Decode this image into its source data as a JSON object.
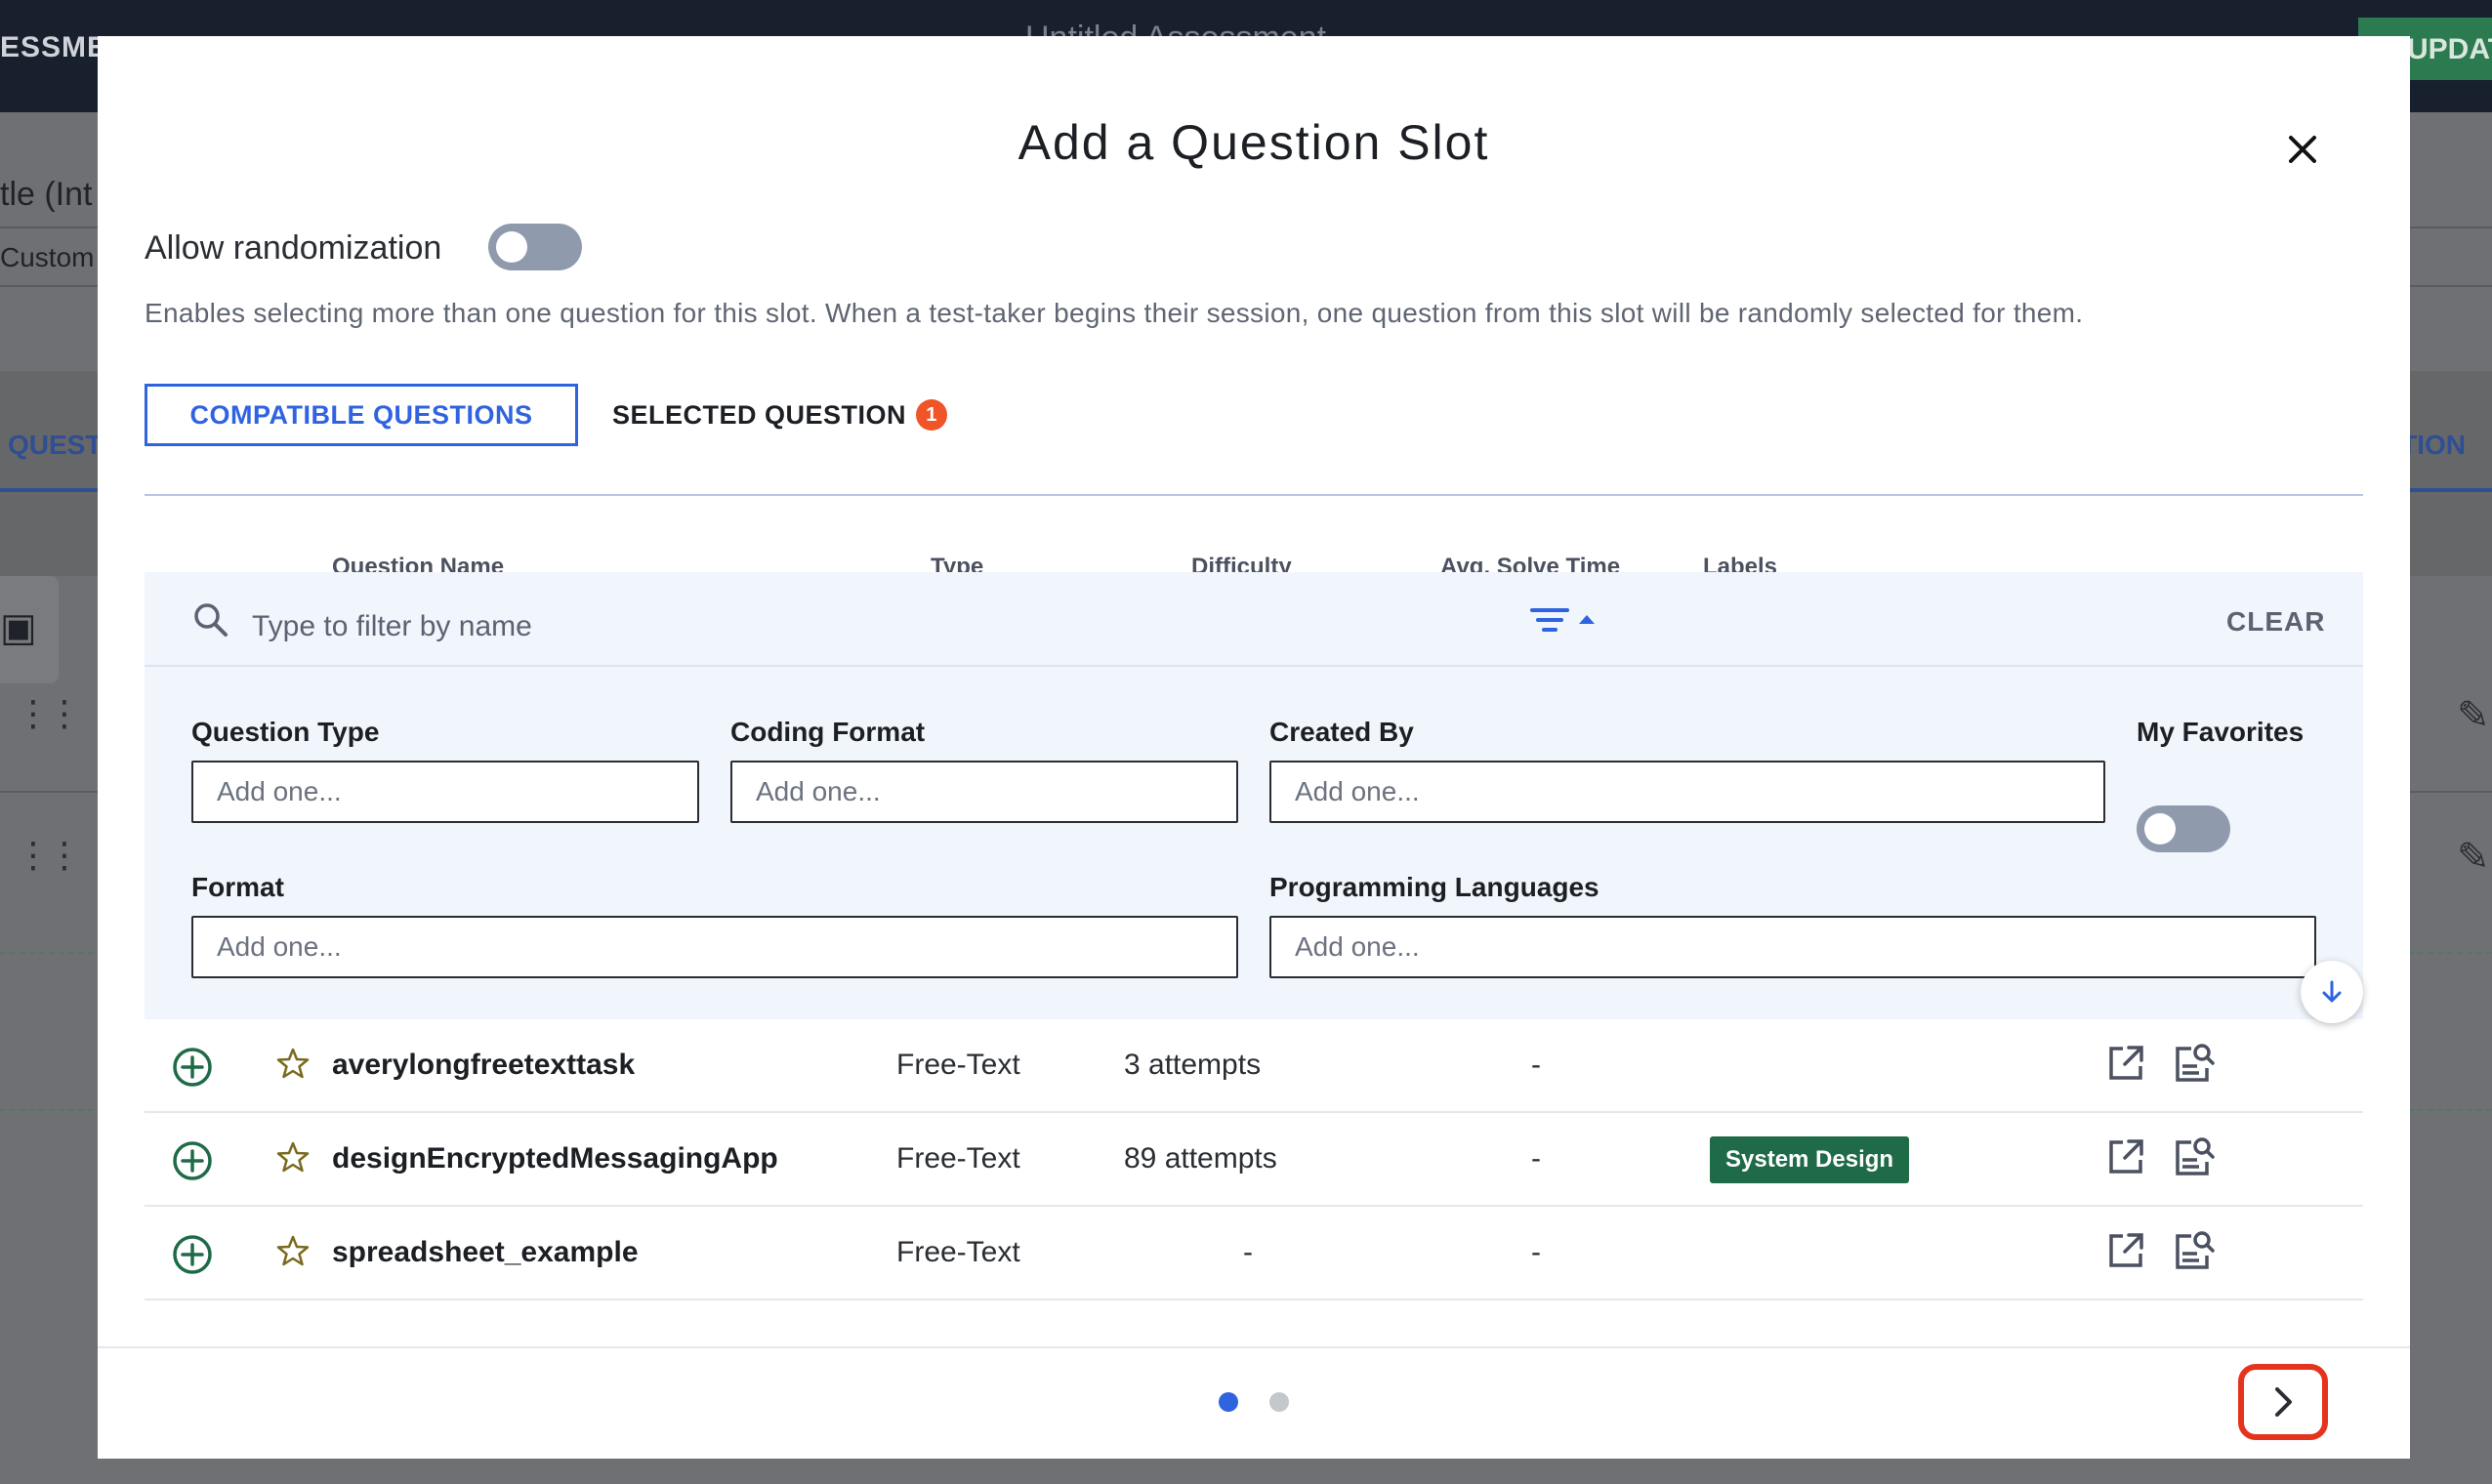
{
  "background": {
    "topbar_left_text": "ESSMENT",
    "topbar_center_text": "Untitled Assessment",
    "update_button_label": "UPDATE",
    "title_fragment": "tle (Int",
    "subtitle_fragment": "Custom",
    "tab_left_fragment": "QUEST",
    "tab_right_fragment": "ATION"
  },
  "modal": {
    "title": "Add a Question Slot",
    "randomization": {
      "label": "Allow randomization",
      "enabled": false,
      "description": "Enables selecting more than one question for this slot. When a test-taker begins their session, one question from this slot will be randomly selected for them."
    },
    "tabs": [
      {
        "label": "COMPATIBLE QUESTIONS",
        "active": true
      },
      {
        "label": "SELECTED QUESTION",
        "badge": "1",
        "active": false
      }
    ],
    "columns": {
      "name": "Question Name",
      "type": "Type",
      "difficulty": "Difficulty",
      "solve_time": "Avg. Solve Time",
      "labels": "Labels"
    },
    "search": {
      "placeholder": "Type to filter by name",
      "value": "",
      "clear_label": "CLEAR"
    },
    "filters": {
      "question_type": {
        "label": "Question Type",
        "placeholder": "Add one..."
      },
      "coding_format": {
        "label": "Coding Format",
        "placeholder": "Add one..."
      },
      "created_by": {
        "label": "Created By",
        "placeholder": "Add one..."
      },
      "my_favorites": {
        "label": "My Favorites",
        "enabled": false
      },
      "format": {
        "label": "Format",
        "placeholder": "Add one..."
      },
      "programming_languages": {
        "label": "Programming Languages",
        "placeholder": "Add one..."
      }
    },
    "questions": [
      {
        "name": "averylongfreetexttask",
        "type": "Free-Text",
        "difficulty": "3 attempts",
        "solve_time": "-",
        "label": ""
      },
      {
        "name": "designEncryptedMessagingApp",
        "type": "Free-Text",
        "difficulty": "89 attempts",
        "solve_time": "-",
        "label": "System Design"
      },
      {
        "name": "spreadsheet_example",
        "type": "Free-Text",
        "difficulty": "-",
        "solve_time": "-",
        "label": ""
      }
    ],
    "pagination": {
      "current_page": 1,
      "total_pages": 2
    }
  },
  "colors": {
    "accent": "#2f63e0",
    "badge": "#f0552a",
    "label_chip": "#1f6b47",
    "highlight_ring": "#e5341e"
  },
  "icons": {
    "close": "close-icon",
    "search": "search-icon",
    "filter": "filter-icon",
    "add": "add-circle-icon",
    "favorite": "star-icon",
    "open": "open-external-icon",
    "preview": "preview-icon",
    "next": "chevron-right-icon",
    "scroll": "arrow-down-icon"
  }
}
